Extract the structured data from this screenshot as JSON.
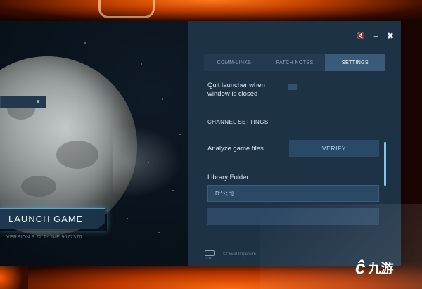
{
  "launcher": {
    "launch_button": "LAUNCH GAME",
    "version": "VERSION 3.22.1-LIVE.9072370"
  },
  "window_controls": {
    "mute_icon": "speaker-muted-icon",
    "minimize": "–",
    "close": "✖"
  },
  "tabs": [
    {
      "label": "COMM-LINKS",
      "active": false
    },
    {
      "label": "PATCH NOTES",
      "active": false
    },
    {
      "label": "SETTINGS",
      "active": true
    }
  ],
  "settings": {
    "quit_line1": "Quit launcher when",
    "quit_line2": "window is closed",
    "channel_title": "CHANNEL SETTINGS",
    "analyze_label": "Analyze game files",
    "verify_button": "VERIFY",
    "library_label": "Library Folder",
    "library_value": "D:\\公司"
  },
  "footer": {
    "logo_text": "CIG",
    "copyright": "©Cloud Imperium"
  },
  "watermark": {
    "logo": "ĉ",
    "text": "九游"
  },
  "colors": {
    "accent": "#395a78",
    "highlight": "#7cc6e2",
    "background_orange": "#ff7a1a"
  }
}
